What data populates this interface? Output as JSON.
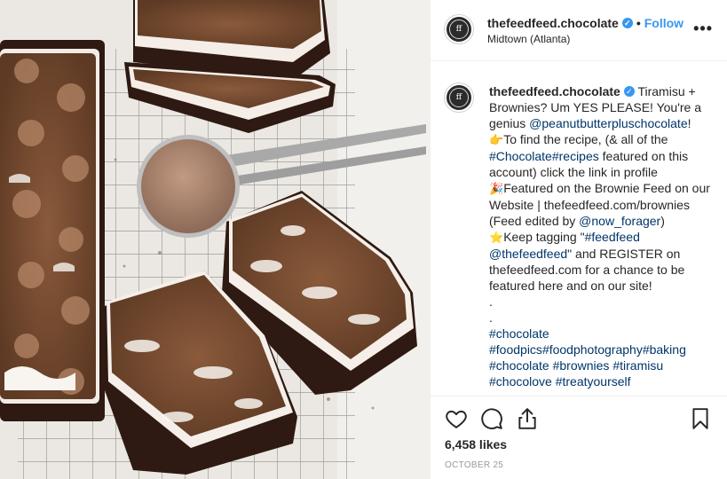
{
  "post": {
    "image_alt": "Tiramisu brownies on a cooling rack with a cocoa sieve"
  },
  "header": {
    "username": "thefeedfeed.chocolate",
    "verified_icon": "verified-badge-icon",
    "separator": "•",
    "follow_label": "Follow",
    "location": "Midtown (Atlanta)",
    "more_icon": "more-options-icon",
    "more_label": "•••"
  },
  "avatar_text": "ff",
  "caption": {
    "username": "thefeedfeed.chocolate",
    "p1": " Tiramisu + Brownies? Um YES PLEASE! You're a genius ",
    "mention1": "@peanutbutterpluschocolate",
    "p2": "!",
    "emoji1": "👉",
    "p3": "To find the recipe, (& all of the ",
    "tag1": "#Chocolate",
    "tag2": "#recipes",
    "p4": " featured on this account) click the link in profile",
    "emoji2": "🎉",
    "p5": "Featured on the Brownie Feed on our Website | thefeedfeed.com/brownies (Feed edited by ",
    "mention2": "@now_forager",
    "p6": ")",
    "emoji3": "⭐",
    "p7": "Keep tagging \"",
    "tag3": "#feedfeed",
    "mention3": "@thefeedfeed",
    "p8": "\" and REGISTER on thefeedfeed.com for a chance to be featured here and on our site!",
    "dots": ".\n.",
    "tags_line1": "#chocolate",
    "tags_line2a": "#foodpics",
    "tags_line2b": "#foodphotography",
    "tags_line2c": "#baking",
    "tags_line3a": "#chocolate",
    "tags_line3b": "#brownies",
    "tags_line3c": "#tiramisu",
    "tags_line4": "#chocolove #treatyourself"
  },
  "actions": {
    "like_icon": "heart-icon",
    "comment_icon": "comment-icon",
    "share_icon": "share-icon",
    "save_icon": "bookmark-icon",
    "likes": "6,458 likes",
    "date": "OCTOBER 25"
  },
  "colors": {
    "link": "#003569",
    "follow": "#3897f0",
    "verified": "#3897f0",
    "muted": "#999999"
  }
}
